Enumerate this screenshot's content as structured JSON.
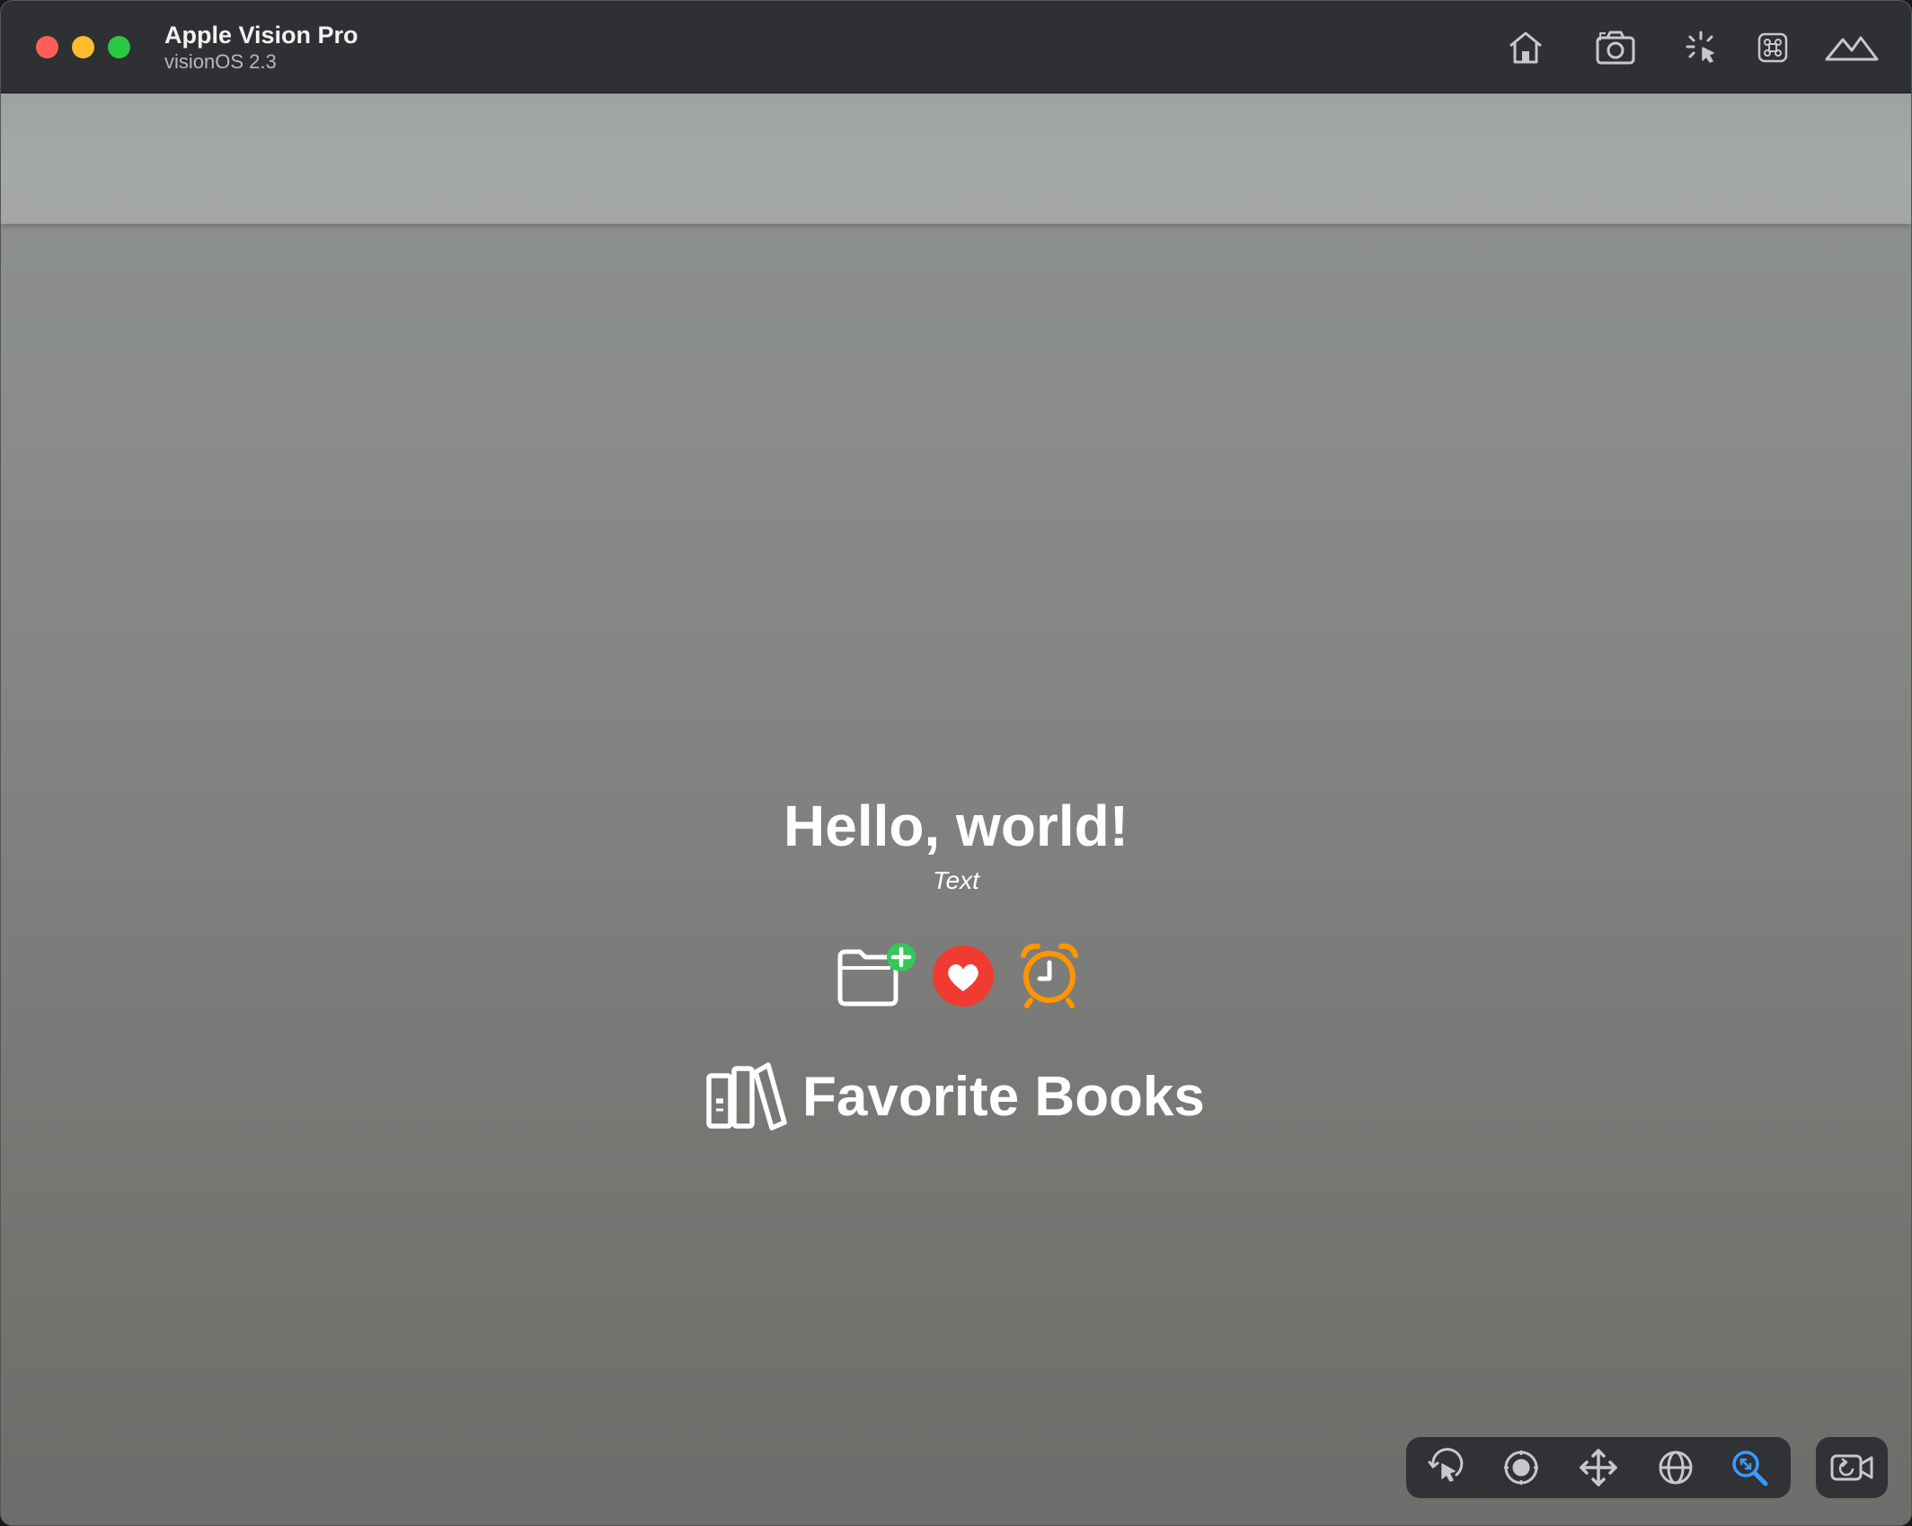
{
  "window": {
    "title": "Apple Vision Pro",
    "subtitle": "visionOS 2.3"
  },
  "toolbar_top": {
    "icons": [
      "home-icon",
      "screenshot-camera-icon",
      "interaction-pointer-icon",
      "command-key-icon",
      "environment-mountains-icon"
    ]
  },
  "scene": {
    "headline": "Hello, world!",
    "caption": "Text",
    "symbols": [
      "folder-badge-plus-icon",
      "heart-circle-icon",
      "alarm-clock-icon"
    ],
    "label": {
      "icon": "books-vertical-icon",
      "text": "Favorite Books"
    }
  },
  "toolbar_bottom": {
    "tools": [
      "select-tool",
      "look-tool",
      "pan-tool",
      "orbit-tool",
      "zoom-tool"
    ],
    "active_tool": "zoom-tool",
    "extra": "reset-camera-icon"
  },
  "colors": {
    "accent": "#3a9bff",
    "heart": "#f23b30",
    "alarm": "#ff9500",
    "plus_badge": "#34c759"
  }
}
